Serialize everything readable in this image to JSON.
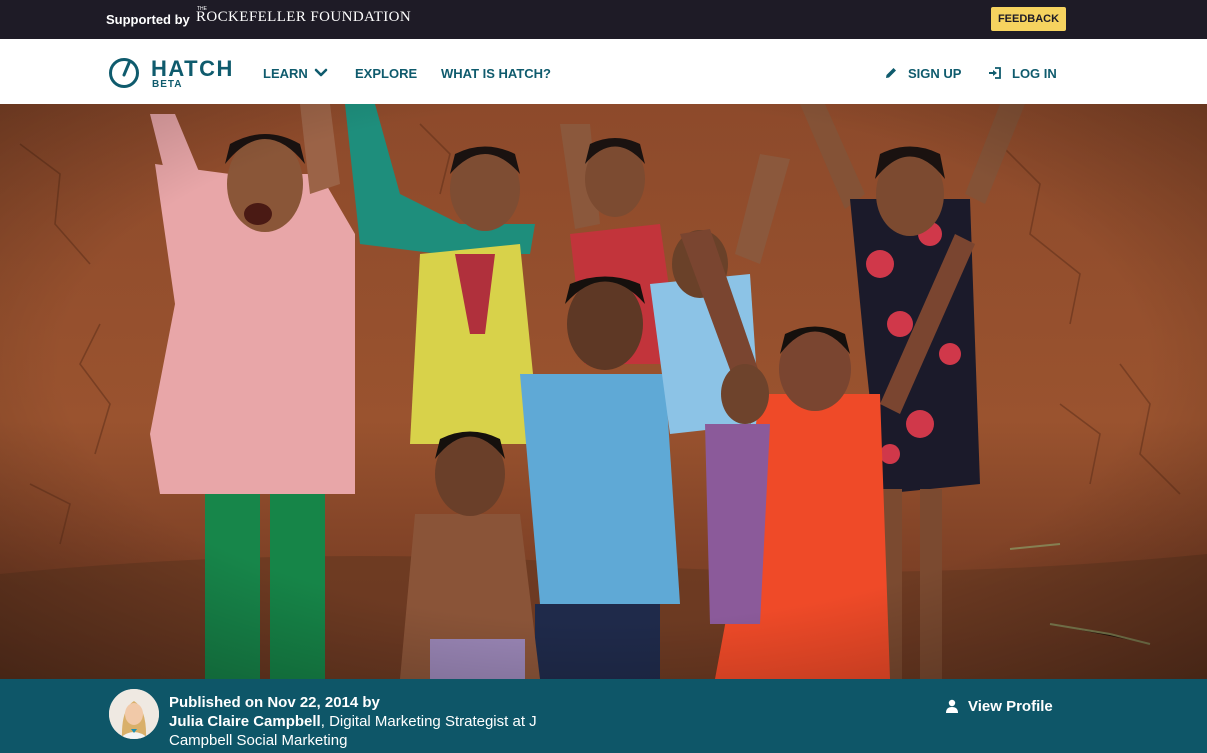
{
  "topbar": {
    "supported_by": "Supported by",
    "foundation_the": "THE",
    "foundation_name": "ROCKEFELLER FOUNDATION",
    "feedback_label": "FEEDBACK"
  },
  "nav": {
    "logo_word": "HATCH",
    "logo_beta": "BETA",
    "learn_label": "LEARN",
    "explore_label": "EXPLORE",
    "what_label": "WHAT IS HATCH?",
    "signup_label": "SIGN UP",
    "login_label": "LOG IN"
  },
  "footer": {
    "published": "Published on Nov 22, 2014 by",
    "author_name": "Julia Claire Campbell",
    "author_title": ", Digital Marketing Strategist at J Campbell Social Marketing",
    "view_profile": "View Profile"
  },
  "colors": {
    "topbar": "#1e1b26",
    "brand": "#0f5b6d",
    "footer": "#0e5668",
    "feedback": "#f6d35f"
  },
  "icons": {
    "logo": "hatch-logo-icon",
    "learn_dropdown": "chevron-down-icon",
    "signup": "pencil-icon",
    "login": "sign-in-icon",
    "view_profile": "user-icon"
  }
}
